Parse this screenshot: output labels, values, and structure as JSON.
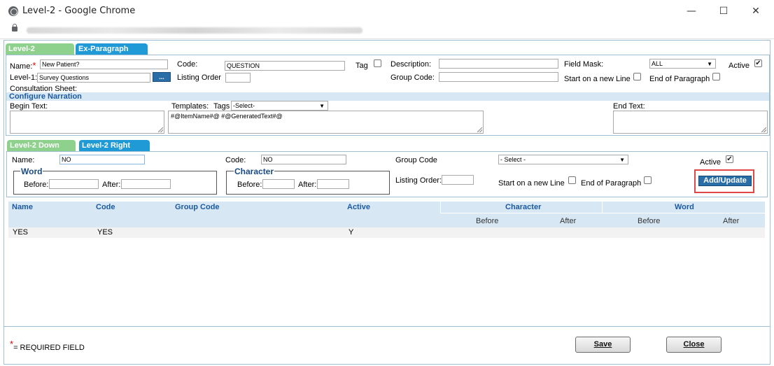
{
  "window": {
    "title": "Level-2 - Google Chrome",
    "minimize": "—",
    "maximize": "☐",
    "close": "✕"
  },
  "top_tabs": [
    "Level-2",
    "Ex-Paragraph"
  ],
  "form": {
    "name_label": "Name:",
    "required_mark": "*",
    "name_value": "New Patient?",
    "code_label": "Code:",
    "code_value": "QUESTION",
    "tag_label": "Tag",
    "description_label": "Description:",
    "description_value": "",
    "field_mask_label": "Field Mask:",
    "field_mask_value": "ALL",
    "active_label": "Active",
    "level1_label": "Level-1:",
    "level1_value": "Survey Questions",
    "dots_button": "...",
    "listing_order_label": "Listing Order",
    "listing_order_value": "",
    "group_code_label": "Group Code:",
    "group_code_value": "",
    "start_new_line_label": "Start on a new Line",
    "end_paragraph_label": "End of Paragraph",
    "consultation_label": "Consultation Sheet:"
  },
  "narration": {
    "header": "Configure Narration",
    "begin_text_label": "Begin Text:",
    "templates_label": "Templates:",
    "tags_label": "Tags",
    "tags_value": "-Select-",
    "template_value": "#@ItemName#@ #@GeneratedText#@",
    "end_text_label": "End Text:"
  },
  "sub_tabs": [
    "Level-2 Down",
    "Level-2 Right"
  ],
  "sub_form": {
    "name_label": "Name:",
    "name_value": "NO",
    "code_label": "Code:",
    "code_value": "NO",
    "group_code_label": "Group Code",
    "group_code_value": "- Select -",
    "active_label": "Active",
    "word_legend": "Word",
    "character_legend": "Character",
    "before_label": "Before:",
    "after_label": "After:",
    "listing_order_label": "Listing Order:",
    "start_new_line_label": "Start on a new Line",
    "end_paragraph_label": "End of Paragraph",
    "add_update_button": "Add/Update"
  },
  "grid": {
    "headers": {
      "name": "Name",
      "code": "Code",
      "group_code": "Group Code",
      "active": "Active",
      "character": "Character",
      "word": "Word",
      "before": "Before",
      "after": "After"
    },
    "rows": [
      {
        "name": "YES",
        "code": "YES",
        "group_code": "",
        "active": "Y"
      }
    ]
  },
  "footer": {
    "required_mark": "*",
    "required_text": "= REQUIRED FIELD",
    "save_button": "Save",
    "close_button": "Close"
  }
}
